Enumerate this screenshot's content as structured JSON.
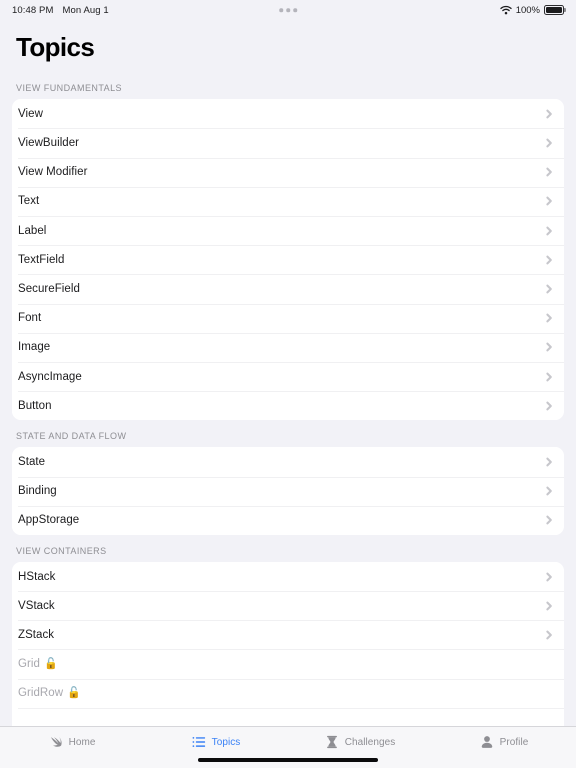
{
  "status_bar": {
    "time": "10:48 PM",
    "date": "Mon Aug 1",
    "battery_percent": "100%",
    "wifi_icon": "wifi-icon",
    "battery_icon": "battery-full-icon",
    "multitask_icon": "multitasking-dots-icon"
  },
  "header": {
    "title": "Topics"
  },
  "sections": [
    {
      "title": "VIEW FUNDAMENTALS",
      "rows": [
        {
          "label": "View",
          "locked": false
        },
        {
          "label": "ViewBuilder",
          "locked": false
        },
        {
          "label": "View Modifier",
          "locked": false
        },
        {
          "label": "Text",
          "locked": false
        },
        {
          "label": "Label",
          "locked": false
        },
        {
          "label": "TextField",
          "locked": false
        },
        {
          "label": "SecureField",
          "locked": false
        },
        {
          "label": "Font",
          "locked": false
        },
        {
          "label": "Image",
          "locked": false
        },
        {
          "label": "AsyncImage",
          "locked": false
        },
        {
          "label": "Button",
          "locked": false
        }
      ]
    },
    {
      "title": "STATE AND DATA FLOW",
      "rows": [
        {
          "label": "State",
          "locked": false
        },
        {
          "label": "Binding",
          "locked": false
        },
        {
          "label": "AppStorage",
          "locked": false
        }
      ]
    },
    {
      "title": "VIEW CONTAINERS",
      "rows": [
        {
          "label": "HStack",
          "locked": false
        },
        {
          "label": "VStack",
          "locked": false
        },
        {
          "label": "ZStack",
          "locked": false
        },
        {
          "label": "Grid",
          "locked": true,
          "lock_glyph": "🔓"
        },
        {
          "label": "GridRow",
          "locked": true,
          "lock_glyph": "🔓"
        },
        {
          "label": "",
          "locked": true
        }
      ]
    }
  ],
  "tabbar": {
    "items": [
      {
        "label": "Home",
        "icon": "swift-swoosh-icon",
        "active": false
      },
      {
        "label": "Topics",
        "icon": "list-bullet-icon",
        "active": true
      },
      {
        "label": "Challenges",
        "icon": "hourglass-icon",
        "active": false
      },
      {
        "label": "Profile",
        "icon": "person-icon",
        "active": false
      }
    ],
    "active_color": "#3b82f6",
    "inactive_color": "#8e8e93"
  },
  "colors": {
    "background": "#f2f2f7",
    "card": "#ffffff",
    "separator": "#e6e6e9",
    "chevron": "#c7c7cc",
    "section_header": "#8e8e93"
  }
}
